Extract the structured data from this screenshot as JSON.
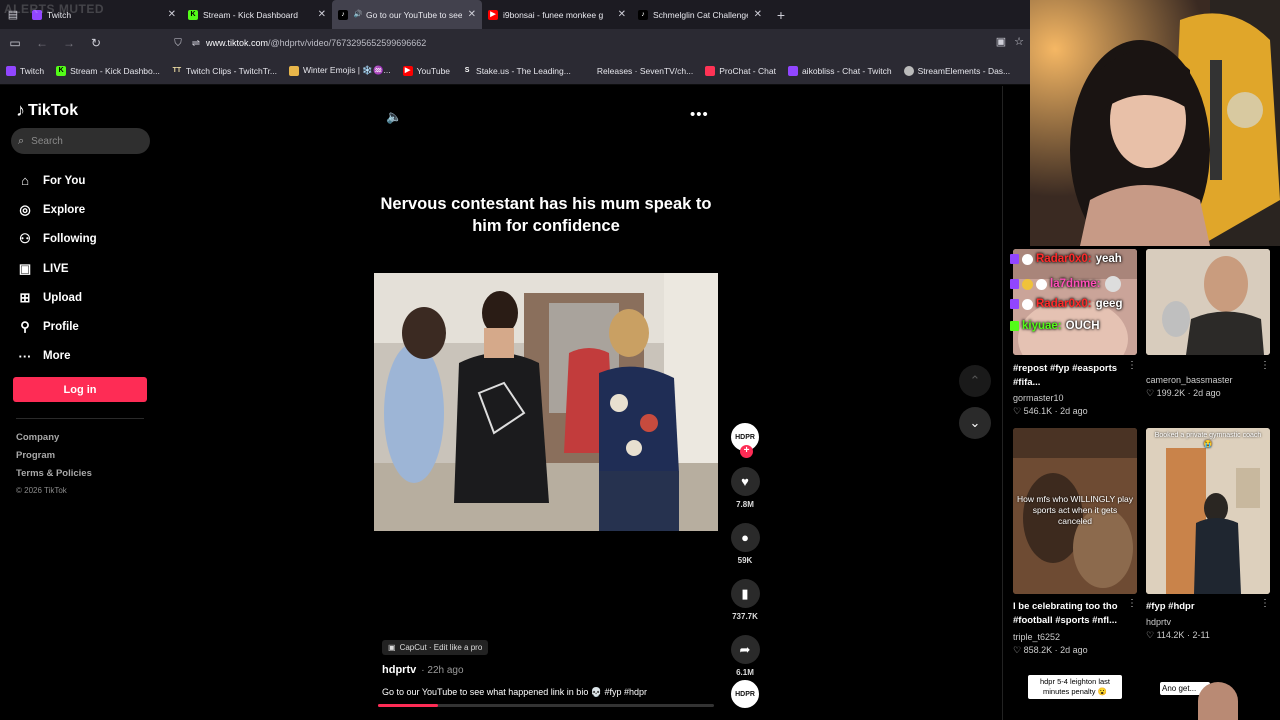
{
  "browser": {
    "watermark": "ALERTS MUTED",
    "tabs": [
      {
        "label": "Twitch",
        "fav_color": "#9146ff"
      },
      {
        "label": "Stream - Kick Dashboard",
        "fav_color": "#53fc18"
      },
      {
        "label": "Go to our YouTube to see w",
        "fav_color": "#000000",
        "active": true
      },
      {
        "label": "i9bonsai - funee monkee g",
        "fav_color": "#ff0000"
      },
      {
        "label": "Schmelglin Cat Challenge: E",
        "fav_color": "#000000"
      }
    ],
    "url_host": "www.tiktok.com",
    "url_path": "/@hdprtv/video/7673295652599696662",
    "bookmarks": [
      {
        "label": "Twitch",
        "color": "#9146ff"
      },
      {
        "label": "Stream - Kick Dashbo...",
        "color": "#53fc18"
      },
      {
        "label": "Twitch Clips - TwitchTr...",
        "color": "#e8d8a0"
      },
      {
        "label": "Winter Emojis | ❄️♒...",
        "color": "#e8b64a"
      },
      {
        "label": "YouTube",
        "color": "#ff0000"
      },
      {
        "label": "Stake.us - The Leading...",
        "color": "#ffffff"
      },
      {
        "label": "Releases · SevenTV/ch...",
        "color": "#2b2a33"
      },
      {
        "label": "ProChat - Chat",
        "color": "#ff3355"
      },
      {
        "label": "aikobliss - Chat - Twitch",
        "color": "#9146ff"
      },
      {
        "label": "StreamElements - Das...",
        "color": "#bbbbbb"
      }
    ]
  },
  "tiktok": {
    "logo": "TikTok",
    "search_placeholder": "Search",
    "nav": [
      {
        "label": "For You",
        "icon": "home-icon"
      },
      {
        "label": "Explore",
        "icon": "compass-icon"
      },
      {
        "label": "Following",
        "icon": "following-icon"
      },
      {
        "label": "LIVE",
        "icon": "live-icon"
      },
      {
        "label": "Upload",
        "icon": "upload-icon"
      },
      {
        "label": "Profile",
        "icon": "profile-icon"
      },
      {
        "label": "More",
        "icon": "more-icon"
      }
    ],
    "login": "Log in",
    "footer": {
      "company": "Company",
      "program": "Program",
      "terms": "Terms & Policies",
      "copyright": "© 2026 TikTok"
    },
    "video": {
      "caption": "Nervous contestant has his mum speak to him for confidence",
      "capcut": "CapCut · Edit like a pro",
      "author": "hdprtv",
      "posted": "· 22h ago",
      "description": "Go to our YouTube to see what happened link in bio 💀 #fyp #hdpr",
      "progress_percent": 18,
      "avatar_text": "HDPR"
    },
    "actions": {
      "likes": "7.8M",
      "comments": "59K",
      "saves": "737.7K",
      "shares": "6.1M"
    },
    "recommended": [
      {
        "title": "#repost #fyp #easports #fifa...",
        "author": "gormaster10",
        "likes": "546.1K",
        "age": "2d ago"
      },
      {
        "title": "",
        "author": "cameron_bassmaster",
        "likes": "199.2K",
        "age": "2d ago"
      },
      {
        "title": "I be celebrating too tho #football #sports #nfl...",
        "author": "triple_t6252",
        "likes": "858.2K",
        "age": "2d ago",
        "overlay": "How mfs who WILLINGLY play sports act when it gets canceled"
      },
      {
        "title": "#fyp #hdpr",
        "author": "hdprtv",
        "likes": "114.2K",
        "age": "2-11",
        "overlay": "Booked a private gymnastic coach 😭"
      },
      {
        "overlay": "hdpr 5-4 leighton last minutes penalty 😮"
      },
      {
        "overlay": "Ano get..."
      }
    ]
  },
  "chat": [
    {
      "user": "Radar0x0:",
      "message": "yeah",
      "user_color": "#ff2a2a",
      "badge": "#9146ff"
    },
    {
      "user": "la7dnme:",
      "message": "",
      "user_color": "#ff4fb8",
      "badge": "#9146ff"
    },
    {
      "user": "Radar0x0:",
      "message": "geeg",
      "user_color": "#ff2a2a",
      "badge": "#9146ff"
    },
    {
      "user": "kiyuae:",
      "message": "OUCH",
      "user_color": "#53fc18",
      "badge": "#53fc18"
    }
  ]
}
